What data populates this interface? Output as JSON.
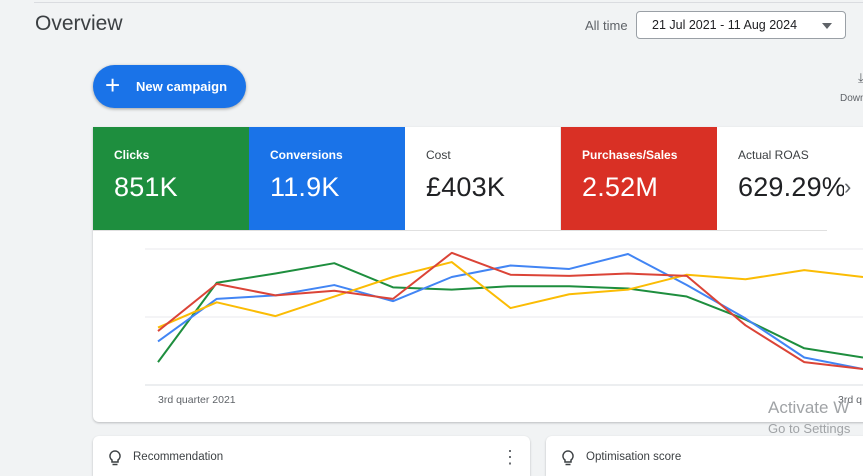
{
  "header": {
    "title": "Overview",
    "range_label": "All time",
    "date_range": "21 Jul 2021 - 11 Aug 2024"
  },
  "toolbar": {
    "new_campaign_label": "New campaign",
    "download_label": "Down"
  },
  "metrics": [
    {
      "label": "Clicks",
      "value": "851K",
      "color": "#1e8e3e",
      "selected": true
    },
    {
      "label": "Conversions",
      "value": "11.9K",
      "color": "#1a73e8",
      "selected": true
    },
    {
      "label": "Cost",
      "value": "£403K",
      "color": "#ffffff",
      "selected": false
    },
    {
      "label": "Purchases/Sales",
      "value": "2.52M",
      "color": "#d93025",
      "selected": true
    },
    {
      "label": "Actual ROAS",
      "value": "629.29%",
      "color": "#ffffff",
      "selected": false
    }
  ],
  "chart_data": {
    "type": "line",
    "x_tick_labels": [
      "3rd quarter 2021",
      "3rd q"
    ],
    "grid": true,
    "series": [
      {
        "color": "#1e8e3e",
        "values": [
          6,
          75,
          83,
          92,
          71,
          69,
          72,
          72,
          70,
          63,
          43,
          18,
          10
        ]
      },
      {
        "color": "#4285f4",
        "values": [
          24,
          61,
          64,
          73,
          59,
          80,
          90,
          87,
          100,
          73,
          44,
          10,
          0
        ]
      },
      {
        "color": "#fbbc04",
        "values": [
          36,
          58,
          46,
          63,
          80,
          93,
          53,
          65,
          69,
          82,
          78,
          86,
          80
        ]
      },
      {
        "color": "#db4437",
        "values": [
          33,
          74,
          64,
          68,
          61,
          101,
          82,
          81,
          83,
          81,
          38,
          6,
          0
        ]
      }
    ]
  },
  "cards": [
    {
      "title": "Recommendation"
    },
    {
      "title": "Optimisation score"
    }
  ],
  "watermark": {
    "line1": "Activate W",
    "line2": "Go to Settings"
  }
}
